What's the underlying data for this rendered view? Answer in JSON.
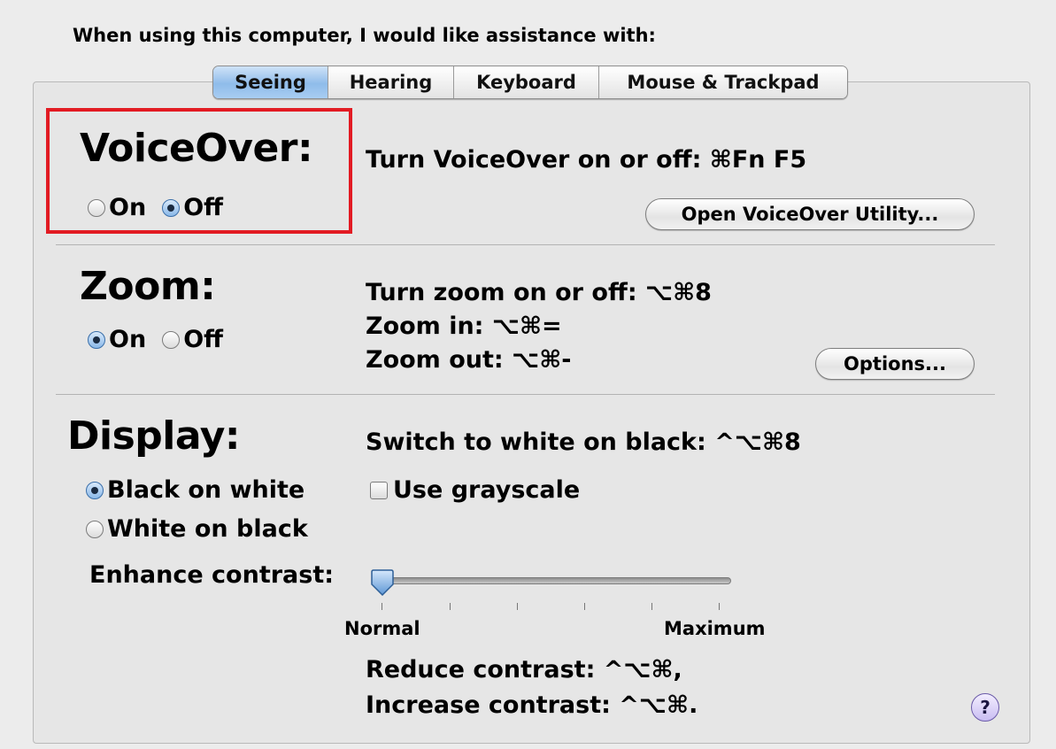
{
  "prompt": "When using this computer, I would like assistance with:",
  "tabs": [
    {
      "label": "Seeing",
      "active": true
    },
    {
      "label": "Hearing",
      "active": false
    },
    {
      "label": "Keyboard",
      "active": false
    },
    {
      "label": "Mouse & Trackpad",
      "active": false
    }
  ],
  "voiceover": {
    "title": "VoiceOver:",
    "on_label": "On",
    "off_label": "Off",
    "selected": "Off",
    "shortcut": "Turn VoiceOver on or off: ⌘Fn F5",
    "utility_button": "Open VoiceOver Utility..."
  },
  "zoom": {
    "title": "Zoom:",
    "on_label": "On",
    "off_label": "Off",
    "selected": "On",
    "shortcut_toggle": "Turn zoom on or off: ⌥⌘8",
    "shortcut_in": "Zoom in: ⌥⌘=",
    "shortcut_out": "Zoom out: ⌥⌘-",
    "options_button": "Options..."
  },
  "display": {
    "title": "Display:",
    "shortcut": "Switch to white on black: ^⌥⌘8",
    "black_on_white": "Black on white",
    "white_on_black": "White on black",
    "selected": "Black on white",
    "grayscale_label": "Use grayscale",
    "grayscale_checked": false,
    "contrast_label": "Enhance contrast:",
    "contrast_value": 0,
    "contrast_min_label": "Normal",
    "contrast_max_label": "Maximum",
    "reduce_contrast": "Reduce contrast: ^⌥⌘,",
    "increase_contrast": "Increase contrast: ^⌥⌘."
  },
  "help_label": "?",
  "colors": {
    "highlight": "#e21b23",
    "active_tab": "#8fbcea",
    "background": "#ececec"
  }
}
